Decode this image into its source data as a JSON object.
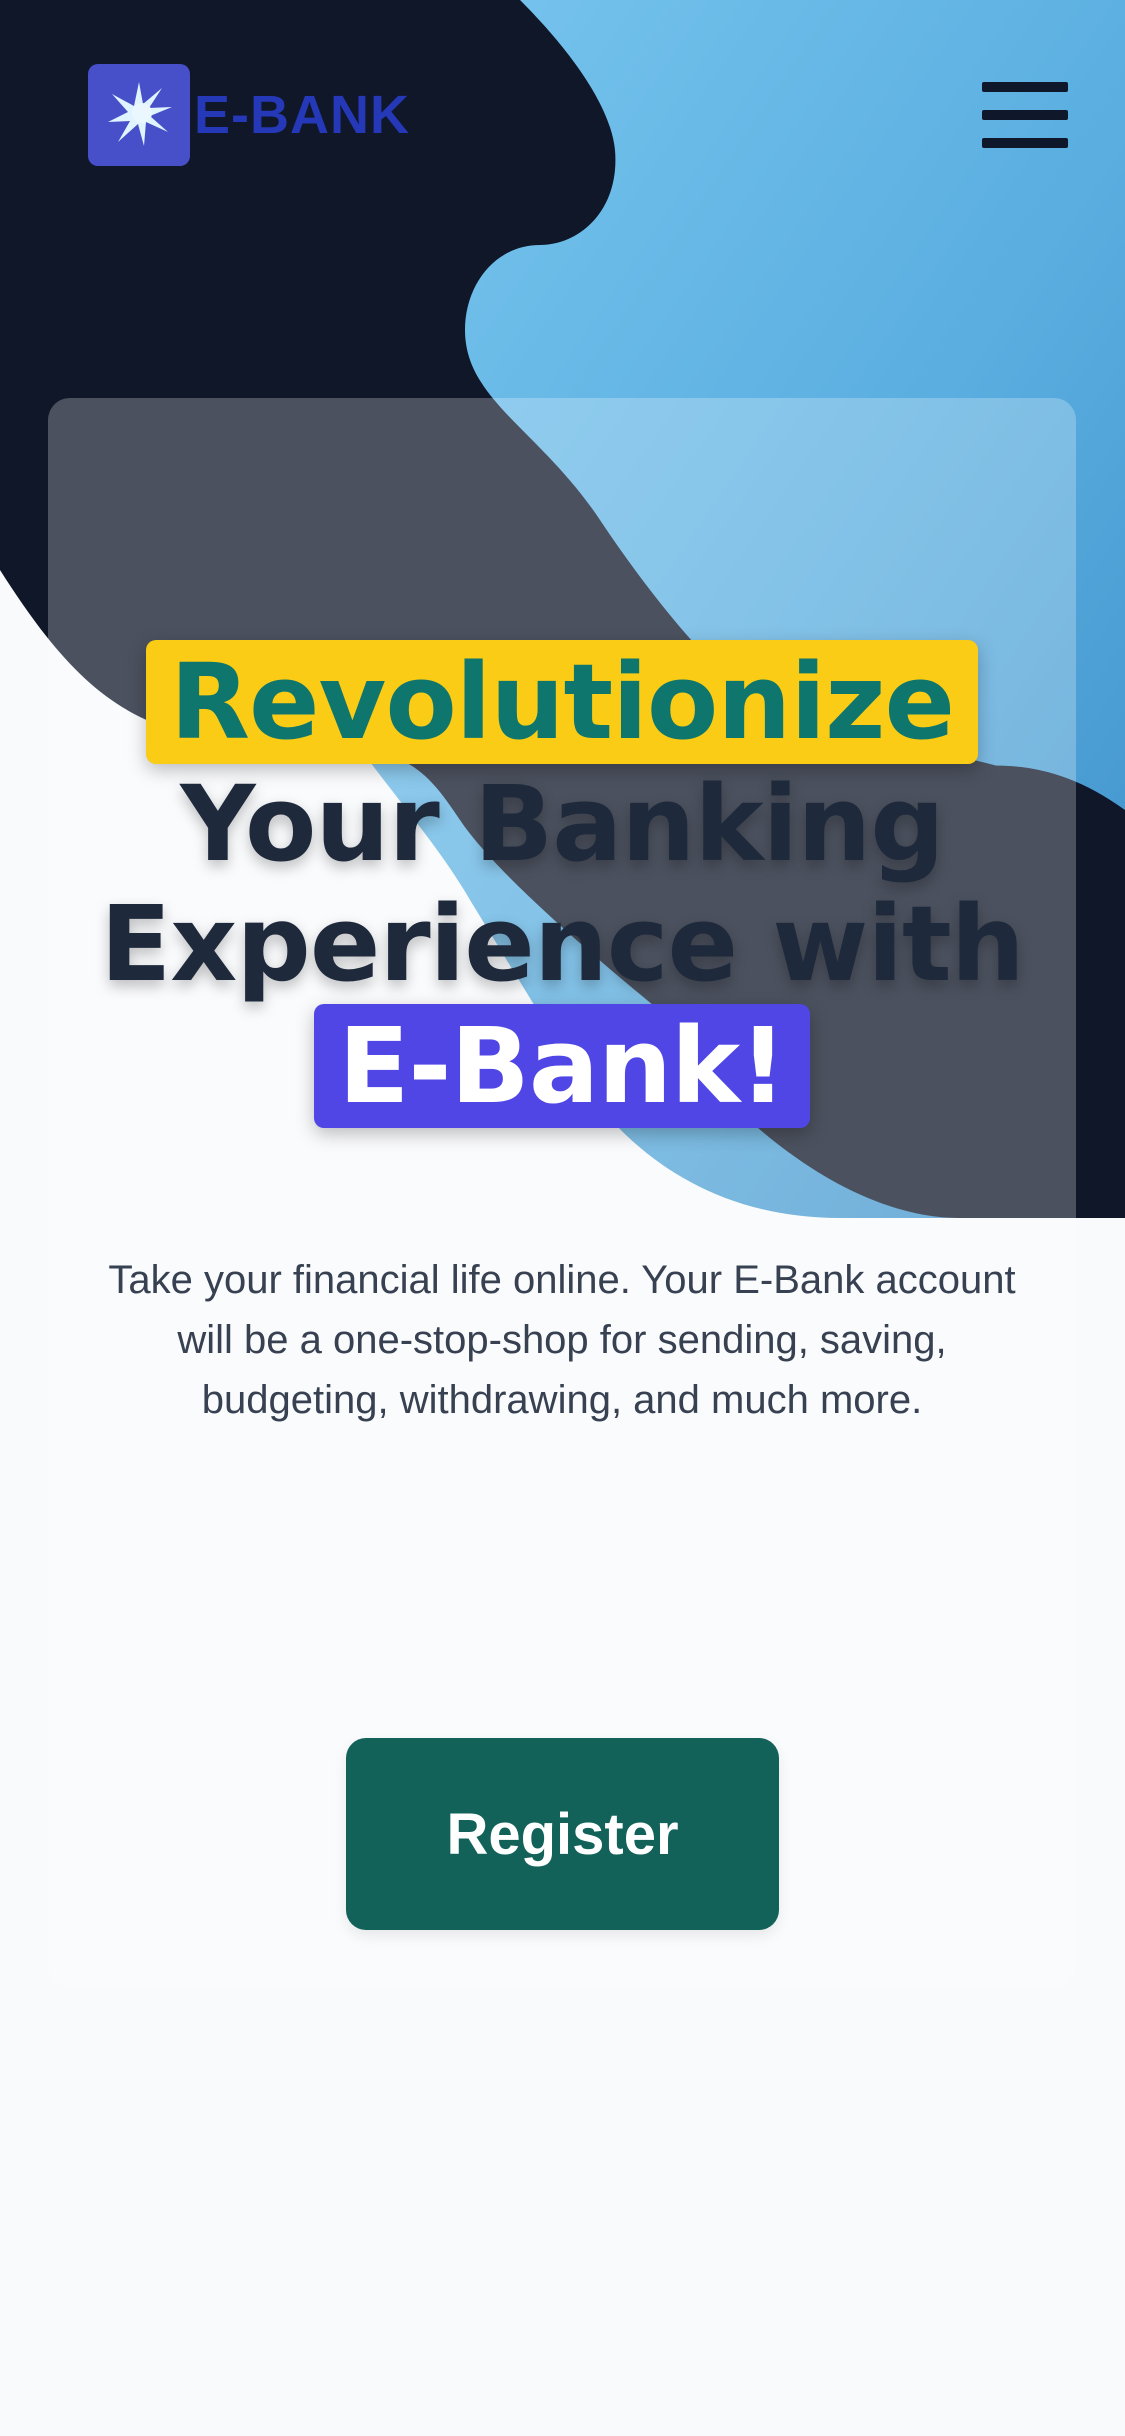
{
  "brand": {
    "name": "E-BANK",
    "logo_icon": "starburst-icon",
    "logo_color": "#4750c8",
    "text_color": "#2538b8"
  },
  "header": {
    "menu_icon": "hamburger-menu-icon"
  },
  "hero": {
    "title_highlight_1": "Revolutionize",
    "title_line_2": "Your Banking",
    "title_line_3": "Experience with",
    "title_highlight_2": "E-Bank!",
    "subtitle": "Take your financial life online. Your E-Bank account will be a one-stop-shop for sending, saving, budgeting, withdrawing, and much more."
  },
  "cta": {
    "register_label": "Register"
  },
  "colors": {
    "dark_navy": "#0f172a",
    "sky_blue": "#5aaee0",
    "highlight_yellow": "#facc15",
    "highlight_teal_text": "#0f766e",
    "highlight_purple": "#4f46e5",
    "button_green": "#12625a",
    "page_background": "#f8fafc"
  }
}
